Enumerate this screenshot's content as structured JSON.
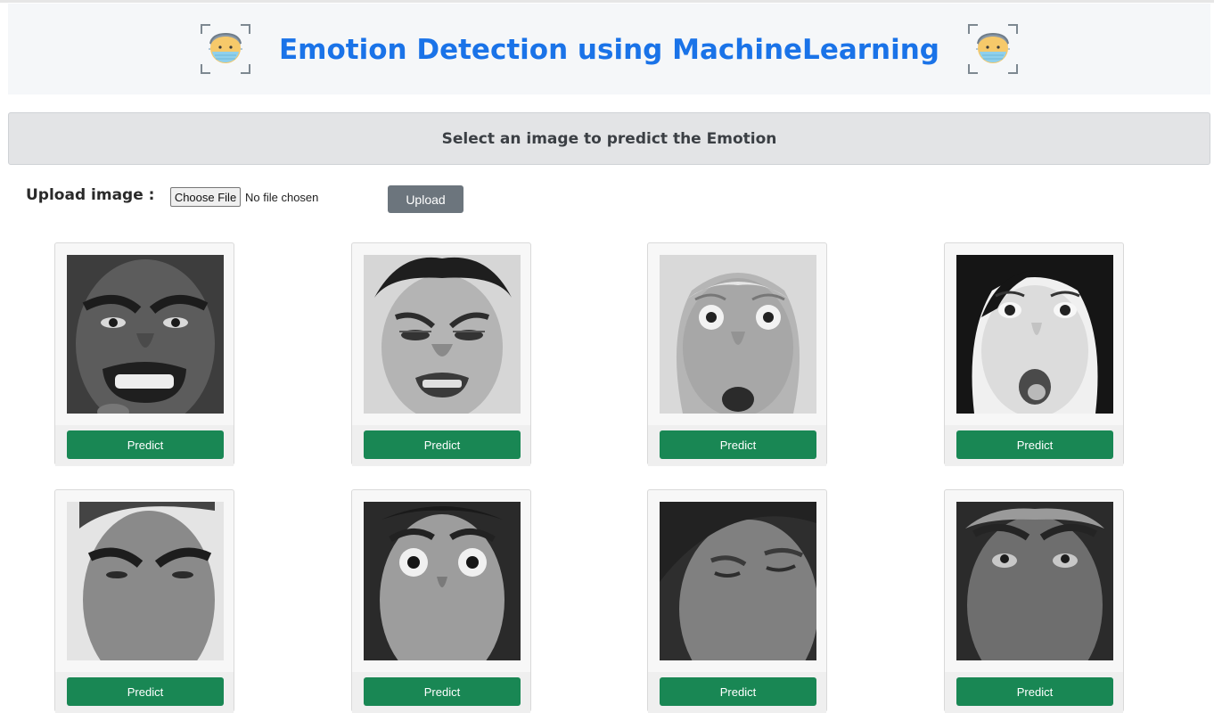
{
  "header": {
    "title": "Emotion Detection using MachineLearning",
    "logo_left_icon": "face-mask-scan-icon",
    "logo_right_icon": "face-mask-scan-icon",
    "title_color": "#1a73e8"
  },
  "banner": {
    "text": "Select an image to predict the Emotion"
  },
  "upload": {
    "label": "Upload image :",
    "choose_file_label": "Choose File",
    "file_status": "No file chosen",
    "upload_button_label": "Upload"
  },
  "gallery": {
    "predict_label": "Predict",
    "accent_color": "#198754",
    "items": [
      {
        "icon": "angry-man-face-photo"
      },
      {
        "icon": "disgusted-man-face-photo"
      },
      {
        "icon": "surprised-woman-face-photo"
      },
      {
        "icon": "surprised-woman-face-photo"
      },
      {
        "icon": "angry-man-face-photo"
      },
      {
        "icon": "fearful-man-face-photo"
      },
      {
        "icon": "sad-woman-face-photo"
      },
      {
        "icon": "fearful-man-face-photo"
      }
    ]
  }
}
